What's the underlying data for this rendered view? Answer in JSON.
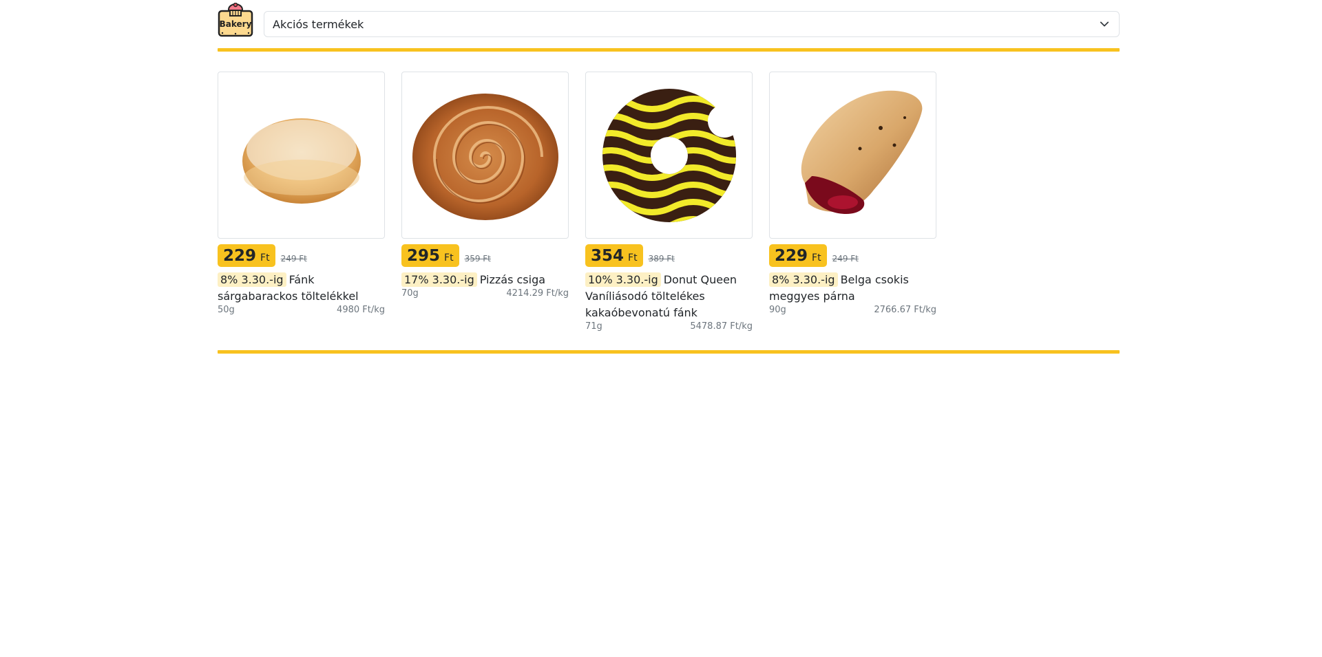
{
  "header": {
    "logo_text": "Bakery",
    "category_select": "Akciós termékek"
  },
  "products": [
    {
      "price": "229",
      "currency": "Ft",
      "old_price": "249 Ft",
      "promo": "8% 3.30.-ig",
      "name": "Fánk sárgabarackos töltelékkel",
      "weight": "50g",
      "unit_price": "4980 Ft/kg",
      "image_icon": "jam-donut-image"
    },
    {
      "price": "295",
      "currency": "Ft",
      "old_price": "359 Ft",
      "promo": "17% 3.30.-ig",
      "name": "Pizzás csiga",
      "weight": "70g",
      "unit_price": "4214.29 Ft/kg",
      "image_icon": "pizza-roll-image"
    },
    {
      "price": "354",
      "currency": "Ft",
      "old_price": "389 Ft",
      "promo": "10% 3.30.-ig",
      "name": "Donut Queen Vaníliásodó töltelékes kakaóbevonatú fánk",
      "weight": "71g",
      "unit_price": "5478.87 Ft/kg",
      "image_icon": "striped-donut-image"
    },
    {
      "price": "229",
      "currency": "Ft",
      "old_price": "249 Ft",
      "promo": "8% 3.30.-ig",
      "name": "Belga csokis meggyes párna",
      "weight": "90g",
      "unit_price": "2766.67 Ft/kg",
      "image_icon": "cherry-pastry-image"
    }
  ],
  "colors": {
    "accent": "#f8c21f",
    "promo_bg": "#fdf0c4",
    "muted": "#6c757d"
  }
}
